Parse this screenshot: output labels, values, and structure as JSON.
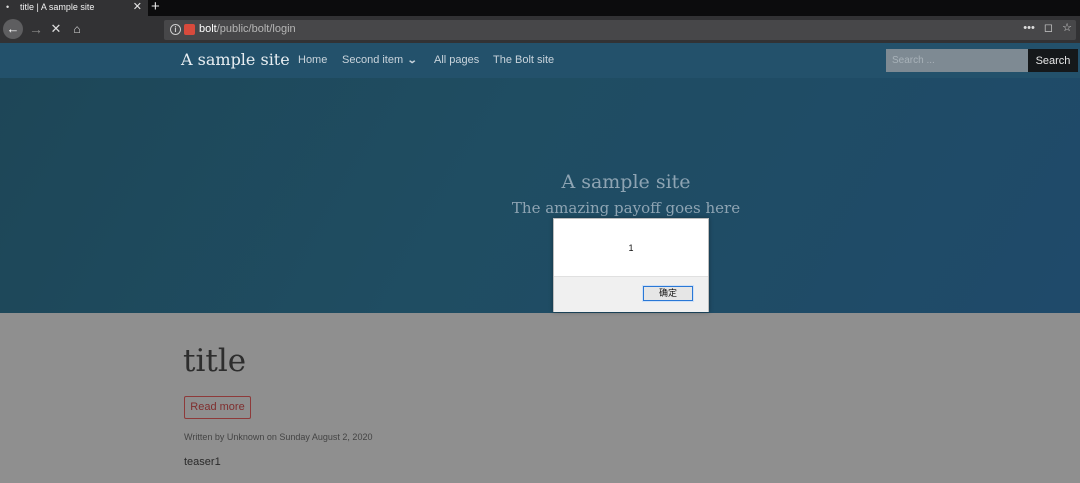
{
  "browser": {
    "tab": {
      "favicon": "dot-icon",
      "title": "title | A sample site",
      "close": "✕"
    },
    "new_tab": "+",
    "nav": {
      "back": "←",
      "forward": "→",
      "stop": "✕",
      "home": "⌂"
    },
    "url": {
      "host": "bolt",
      "path": "/public/bolt/login"
    },
    "actions": {
      "more": "•••",
      "pocket": "◻",
      "bookmark": "☆"
    }
  },
  "site": {
    "brand": "A sample site",
    "menu": [
      {
        "label": "Home"
      },
      {
        "label": "Second item",
        "caret": "⌄"
      },
      {
        "label": "All pages"
      },
      {
        "label": "The Bolt site"
      }
    ],
    "search": {
      "placeholder": "Search ...",
      "button": "Search"
    },
    "hero": {
      "title": "A sample site",
      "subtitle": "The amazing payoff goes here"
    }
  },
  "post": {
    "title": "title",
    "read_more": "Read more",
    "meta": "Written by Unknown on Sunday August 2, 2020",
    "teaser": "teaser1"
  },
  "dialog": {
    "message": "1",
    "ok_label": "确定"
  }
}
